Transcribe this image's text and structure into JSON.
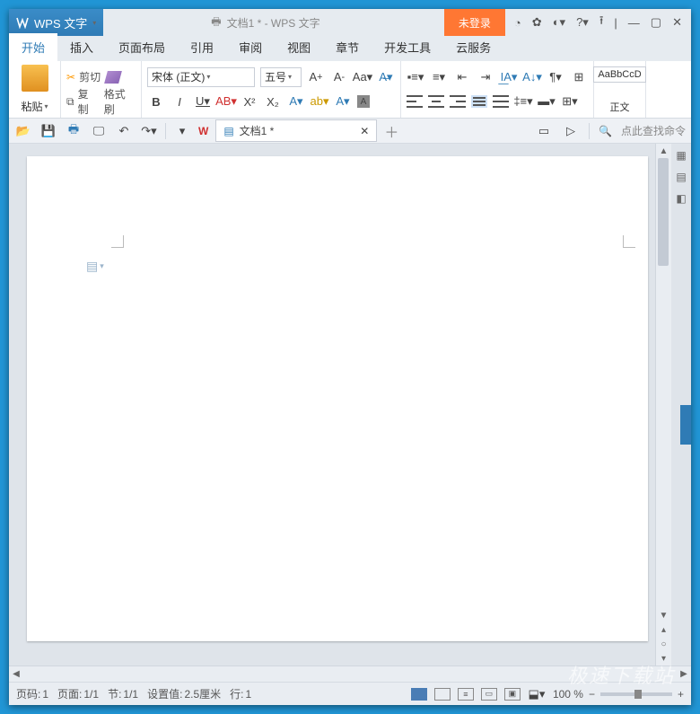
{
  "title": {
    "app": "WPS 文字",
    "doc_center": "文档1 * - WPS 文字",
    "login": "未登录"
  },
  "menus": {
    "start": "开始",
    "insert": "插入",
    "layout": "页面布局",
    "ref": "引用",
    "review": "审阅",
    "view": "视图",
    "chapter": "章节",
    "dev": "开发工具",
    "cloud": "云服务"
  },
  "ribbon": {
    "paste": "粘贴",
    "cut": "剪切",
    "copy": "复制",
    "format_paint": "格式刷",
    "font_name": "宋体 (正文)",
    "font_size": "五号",
    "style_preview": "AaBbCcD",
    "style_label": "正文"
  },
  "qat": {
    "doc_tab": "文档1 *",
    "search": "点此查找命令"
  },
  "status": {
    "page_no_lbl": "页码:",
    "page_no": "1",
    "pages_lbl": "页面:",
    "pages": "1/1",
    "section_lbl": "节:",
    "section": "1/1",
    "setval_lbl": "设置值:",
    "setval": "2.5厘米",
    "line_lbl": "行:",
    "line": "1",
    "zoom": "100 %"
  },
  "watermark": "极速下载站"
}
